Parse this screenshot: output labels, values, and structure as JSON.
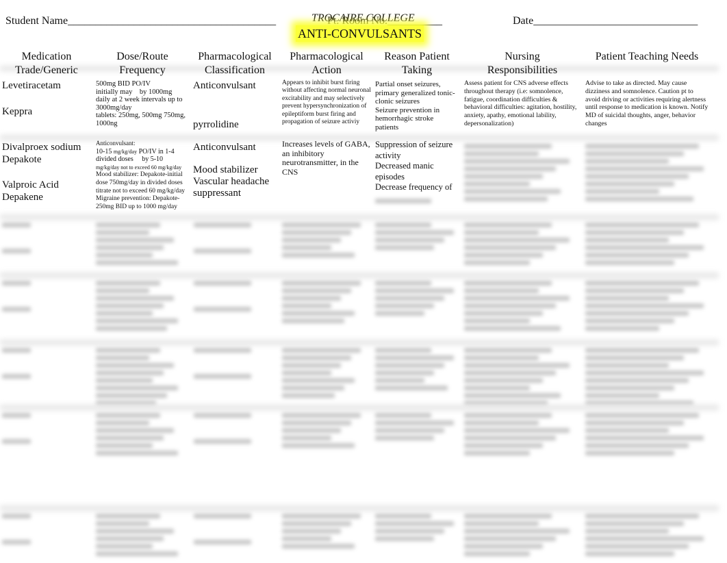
{
  "header": {
    "student_name": "Student Name______________________________________",
    "college": "TROCAIRE COLLEGE",
    "room": "Pt. Room No.__________",
    "date": "Date______________________________",
    "title": "ANTI-CONVULSANTS"
  },
  "columns": [
    {
      "l1": "Medication",
      "l2": "Trade/Generic"
    },
    {
      "l1": "Dose/Route",
      "l2": "Frequency"
    },
    {
      "l1": "Pharmacological",
      "l2": "Classification"
    },
    {
      "l1": "Pharmacological",
      "l2": "Action"
    },
    {
      "l1": "Reason Patient",
      "l2": "Taking"
    },
    {
      "l1": "Nursing",
      "l2": "Responsibilities"
    },
    {
      "l1": "Patient Teaching Needs",
      "l2": ""
    }
  ],
  "rows": [
    {
      "generic": "Levetiracetam",
      "trade": "Keppra",
      "dose": [
        "500mg BID PO/IV",
        "initially may    by 1000mg",
        "daily at 2 week intervals up to",
        "3000mg/day",
        "tablets: 250mg, 500mg 750mg,",
        "1000ng"
      ],
      "class1": "Anticonvulsant",
      "class2": "pyrrolidine",
      "action": "Appears to inhibit burst firing without affecting normal neuronal excitability and may selectively prevent hypersynchronization of epileptiform burst firing and propagation of seizure activiy",
      "reason": [
        "Partial onset seizures,",
        "primary generalized tonic-",
        "clonic seizures",
        "Seizure prevention in",
        "hemorrhagic stroke",
        "patients"
      ],
      "nursing": "Assess patient for CNS adverse effects throughout therapy (i.e: somnolence, fatigue, coordination difficulties & behavioral difficulties: agitation, hostility, anxiety, apathy, emotional lability, depersonalization)",
      "teaching": "Advise to take as directed. May cause dizziness and somnolence. Caution pt to avoid driving or activities requiring alertness until response to medication is known. Notify MD of suicidal thoughts, anger, behavior changes"
    },
    {
      "generic1": "Divalproex sodium",
      "trade1": "Depakote",
      "generic2": "Valproic Acid",
      "trade2": "Depakene",
      "dose": [
        "Anticonvulsant:",
        "10-15 ",
        "mg/kg/day",
        " PO/IV in 1-4",
        "divided doses     by 5-10",
        "mg/kg/day not to exceed 60  mg/kg/day",
        "Mood stabilizer: Depakote-initial",
        "dose 750mg/day in divided doses",
        "titrate not to exceed 60 mg/kg/day",
        "Migraine prevention: Depakote-",
        "250mg BID up to 1000 mg/day"
      ],
      "class1": "Anticonvulsant",
      "class2": "Mood stabilizer",
      "class3": "Vascular headache",
      "class4": "suppressant",
      "action": "Increases levels of GABA, an inhibitory neurotransmitter, in the CNS",
      "reason": [
        "Suppression of seizure",
        "activity",
        "Decreased manic",
        "episodes",
        "Decrease frequency of"
      ]
    }
  ]
}
